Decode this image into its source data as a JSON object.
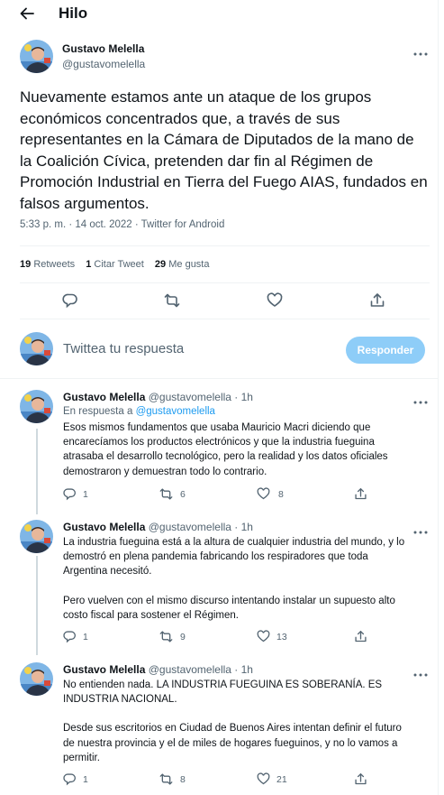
{
  "header": {
    "title": "Hilo"
  },
  "main_tweet": {
    "author_name": "Gustavo Melella",
    "author_handle": "@gustavomelella",
    "text": "Nuevamente estamos ante un ataque de los grupos económicos concentrados que, a través de sus representantes en la Cámara de Diputados de la mano de la Coalición Cívica, pretenden dar fin al Régimen de Promoción Industrial en Tierra del Fuego AIAS, fundados en falsos argumentos.",
    "timestamp": "5:33 p. m. · 14 oct. 2022 · Twitter for Android",
    "stats": {
      "retweets_count": "19",
      "retweets_label": "Retweets",
      "quotes_count": "1",
      "quotes_label": "Citar Tweet",
      "likes_count": "29",
      "likes_label": "Me gusta"
    }
  },
  "composer": {
    "placeholder": "Twittea tu respuesta",
    "button_label": "Responder"
  },
  "replies": [
    {
      "author_name": "Gustavo Melella",
      "meta": "@gustavomelella · 1h",
      "in_reply_prefix": "En respuesta a",
      "in_reply_handle": "@gustavomelella",
      "lines": [
        "Esos mismos fundamentos que usaba Mauricio Macri diciendo que",
        "encarecíamos los productos electrónicos y que la industria fueguina",
        "atrasaba el desarrollo tecnológico, pero la realidad y los datos oficiales",
        "demostraron y demuestran todo lo contrario."
      ],
      "replies_count": "1",
      "retweets_count": "6",
      "likes_count": "8"
    },
    {
      "author_name": "Gustavo Melella",
      "meta": "@gustavomelella · 1h",
      "lines": [
        "La industria fueguina está a la altura de cualquier industria del mundo, y lo",
        "demostró en plena pandemia fabricando los respiradores que toda",
        "Argentina necesitó.",
        "",
        "Pero vuelven con el mismo discurso intentando instalar un supuesto alto",
        "costo fiscal para sostener el Régimen."
      ],
      "replies_count": "1",
      "retweets_count": "9",
      "likes_count": "13"
    },
    {
      "author_name": "Gustavo Melella",
      "meta": "@gustavomelella · 1h",
      "lines": [
        "No entienden nada. LA INDUSTRIA FUEGUINA ES SOBERANÍA. ES",
        "INDUSTRIA NACIONAL.",
        "",
        "Desde sus escritorios en Ciudad de Buenos Aires intentan definir el futuro",
        "de nuestra provincia y el de miles de hogares fueguinos, y no lo vamos a",
        "permitir."
      ],
      "replies_count": "1",
      "retweets_count": "8",
      "likes_count": "21"
    }
  ],
  "colors": {
    "accent": "#1d9bf0",
    "button_disabled": "#8ecdf8",
    "secondary_text": "#536471"
  }
}
